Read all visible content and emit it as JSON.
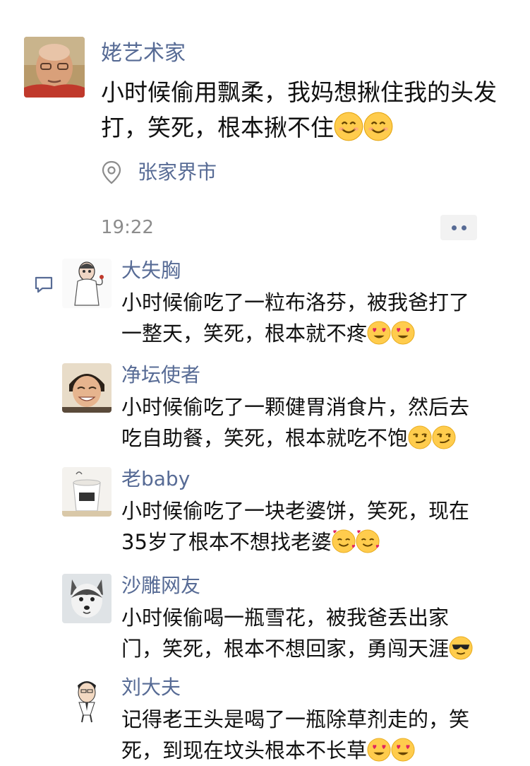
{
  "post": {
    "author": "姥艺术家",
    "text": "小时候偷用飘柔，我妈想揪住我的头发打，笑死，根本揪不住",
    "emojis": [
      "smile-emoji",
      "smile-emoji"
    ],
    "location": "张家界市",
    "time": "19:22"
  },
  "comments": [
    {
      "name": "大失胸",
      "text": "小时候偷吃了一粒布洛芬，被我爸打了一整天，笑死，根本就不疼",
      "emojis": [
        "heart-eyes-emoji",
        "heart-eyes-emoji"
      ]
    },
    {
      "name": "净坛使者",
      "text": "小时候偷吃了一颗健胃消食片，然后去吃自助餐，笑死，根本就吃不饱",
      "emojis": [
        "smirk-emoji",
        "smirk-emoji"
      ]
    },
    {
      "name": "老baby",
      "text": "小时候偷吃了一块老婆饼，笑死，现在35岁了根本不想找老婆",
      "emojis": [
        "smiling-hearts-emoji",
        "smiling-hearts-emoji"
      ]
    },
    {
      "name": "沙雕网友",
      "text": "小时候偷喝一瓶雪花，被我爸丢出家门，笑死，根本不想回家，勇闯天涯",
      "emojis": [
        "sunglasses-emoji"
      ]
    },
    {
      "name": "刘大夫",
      "text": "记得老王头是喝了一瓶除草剂走的，笑死，到现在坟头根本不长草",
      "emojis": [
        "heart-eyes-emoji",
        "heart-eyes-emoji"
      ]
    }
  ],
  "colors": {
    "name_link": "#576b95",
    "time_gray": "#8c8c8c",
    "text": "#111111"
  }
}
